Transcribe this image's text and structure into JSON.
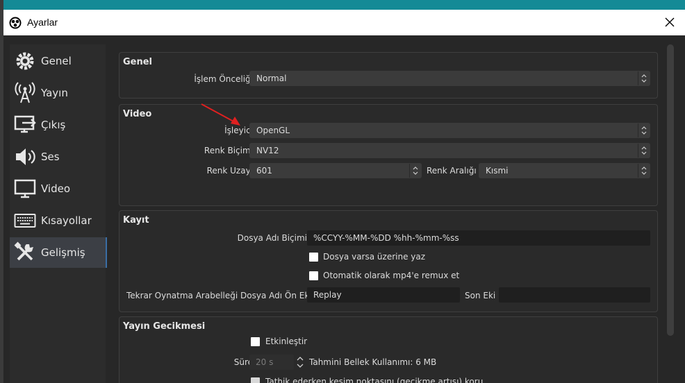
{
  "window": {
    "title": "Ayarlar"
  },
  "sidebar": {
    "items": [
      {
        "label": "Genel",
        "icon": "gear-icon"
      },
      {
        "label": "Yayın",
        "icon": "broadcast-icon"
      },
      {
        "label": "Çıkış",
        "icon": "output-icon"
      },
      {
        "label": "Ses",
        "icon": "speaker-icon"
      },
      {
        "label": "Video",
        "icon": "monitor-icon"
      },
      {
        "label": "Kısayollar",
        "icon": "keyboard-icon"
      },
      {
        "label": "Gelişmiş",
        "icon": "tools-icon"
      }
    ],
    "active": "Gelişmiş"
  },
  "general": {
    "title": "Genel",
    "process_priority_label": "İşlem Önceliği",
    "process_priority_value": "Normal"
  },
  "video": {
    "title": "Video",
    "renderer_label": "İşleyici",
    "renderer_value": "OpenGL",
    "color_format_label": "Renk Biçimi",
    "color_format_value": "NV12",
    "color_space_label": "Renk Uzayı",
    "color_space_value": "601",
    "color_range_label": "Renk Aralığı",
    "color_range_value": "Kısmi"
  },
  "recording": {
    "title": "Kayıt",
    "filename_format_label": "Dosya Adı Biçimi",
    "filename_format_value": "%CCYY-%MM-%DD %hh-%mm-%ss",
    "overwrite_label": "Dosya varsa üzerine yaz",
    "overwrite_checked": false,
    "remux_label": "Otomatik olarak mp4'e remux et",
    "remux_checked": false,
    "replay_prefix_label": "Tekrar Oynatma Arabelleği Dosya Adı Ön Eki",
    "replay_prefix_value": "Replay",
    "suffix_label": "Son Eki",
    "suffix_value": ""
  },
  "stream_delay": {
    "title": "Yayın Gecikmesi",
    "enable_label": "Etkinleştir",
    "enable_checked": false,
    "duration_label": "Süre",
    "duration_value": "20 s",
    "memory_usage": "Tahmini Bellek Kullanımı: 6 MB",
    "preserve_label": "Tathik ederken kesim noktasını (gecikme artışı) koru"
  },
  "colors": {
    "accent": "#3a6ea5",
    "arrow": "#e02020",
    "taskbar": "#148a96"
  }
}
